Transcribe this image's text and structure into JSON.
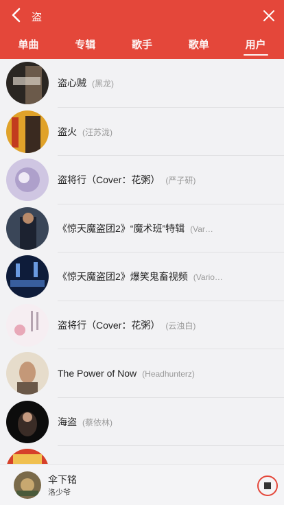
{
  "header": {
    "query": "盗",
    "back_icon": "back-arrow-icon",
    "close_icon": "close-icon",
    "bg_color": "#e4473a"
  },
  "tabs": [
    {
      "label": "单曲",
      "active": false
    },
    {
      "label": "专辑",
      "active": false
    },
    {
      "label": "歌手",
      "active": false
    },
    {
      "label": "歌单",
      "active": false
    },
    {
      "label": "用户",
      "active": true
    }
  ],
  "results": [
    {
      "title": "盗心贼",
      "artist": "(黑龙)"
    },
    {
      "title": "盗火",
      "artist": "(汪苏泷)"
    },
    {
      "title": "盗将行（Cover：花粥）",
      "artist": "(严子研)"
    },
    {
      "title": "《惊天魔盗团2》“魔术班”特辑",
      "artist": "(Var…"
    },
    {
      "title": "《惊天魔盗团2》爆笑鬼畜视频",
      "artist": "(Vario…"
    },
    {
      "title": "盗将行（Cover：花粥）",
      "artist": "(云浊白)"
    },
    {
      "title": "The Power of Now",
      "artist": "(Headhunterz)"
    },
    {
      "title": "海盗",
      "artist": "(蔡依林)"
    },
    {
      "title": "",
      "artist": ""
    }
  ],
  "player": {
    "title": "伞下铭",
    "artist": "洛少爷",
    "stop_icon": "stop-icon",
    "accent": "#e4473a"
  }
}
